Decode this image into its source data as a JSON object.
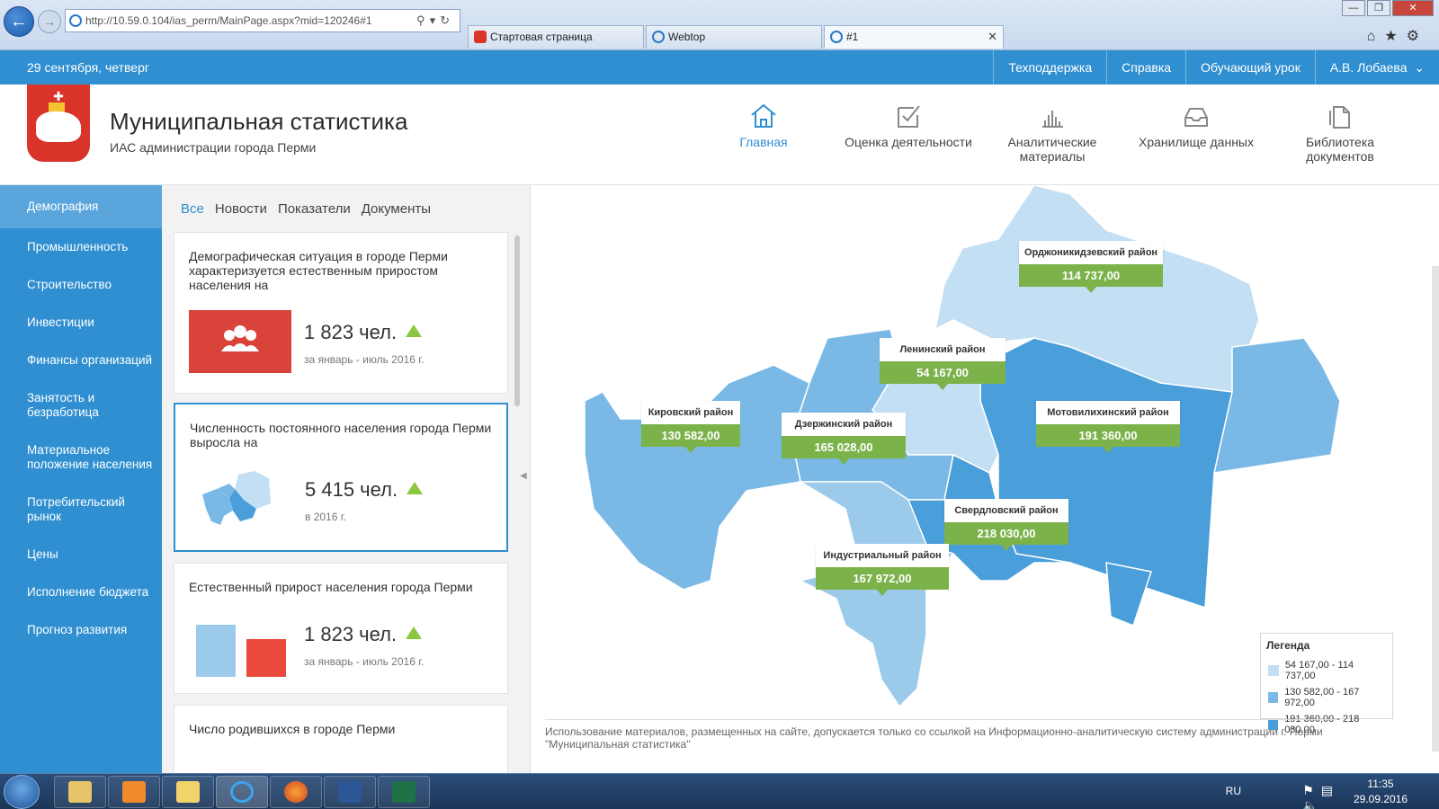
{
  "browser": {
    "address": "http://10.59.0.104/ias_perm/MainPage.aspx?mid=120246#1",
    "tabs": [
      "Стартовая страница",
      "Webtop",
      "#1"
    ]
  },
  "topbar": {
    "date": "29 сентября, четверг",
    "links": [
      "Техподдержка",
      "Справка",
      "Обучающий урок",
      "А.В. Лобаева"
    ]
  },
  "header": {
    "title": "Муниципальная статистика",
    "subtitle": "ИАС администрации города Перми",
    "nav": [
      "Главная",
      "Оценка деятельности",
      "Аналитические материалы",
      "Хранилище данных",
      "Библиотека документов"
    ]
  },
  "sidebar": {
    "items": [
      "Демография",
      "Промышленность",
      "Строительство",
      "Инвестиции",
      "Финансы организаций",
      "Занятость и безработица",
      "Материальное положение населения",
      "Потребительский рынок",
      "Цены",
      "Исполнение бюджета",
      "Прогноз развития"
    ]
  },
  "feed": {
    "tabs": [
      "Все",
      "Новости",
      "Показатели",
      "Документы"
    ],
    "cards": [
      {
        "text": "Демографическая ситуация в городе Перми характеризуется естественным приростом населения на",
        "value": "1 823 чел.",
        "period": "за январь - июль 2016 г."
      },
      {
        "text": "Численность постоянного населения города Перми выросла на",
        "value": "5 415 чел.",
        "period": "в 2016 г."
      },
      {
        "text": "Естественный прирост населения города Перми",
        "value": "1 823 чел.",
        "period": "за январь - июль 2016 г."
      },
      {
        "text": "Число родившихся в городе Перми",
        "value": "",
        "period": ""
      }
    ]
  },
  "map": {
    "districts": [
      {
        "name": "Орджоникидзевский район",
        "value": "114 737,00"
      },
      {
        "name": "Ленинский район",
        "value": "54 167,00"
      },
      {
        "name": "Кировский район",
        "value": "130 582,00"
      },
      {
        "name": "Дзержинский район",
        "value": "165 028,00"
      },
      {
        "name": "Мотовилихинский район",
        "value": "191 360,00"
      },
      {
        "name": "Свердловский район",
        "value": "218 030,00"
      },
      {
        "name": "Индустриальный район",
        "value": "167 972,00"
      }
    ],
    "legend": {
      "title": "Легенда",
      "ranges": [
        "54 167,00 - 114 737,00",
        "130 582,00 - 167 972,00",
        "191 360,00 - 218 030,00"
      ]
    },
    "colors": {
      "light": "#c3dff3",
      "medium": "#7ab9e5",
      "dark": "#4a9ed9",
      "label": "#7cb24a"
    },
    "footer": "Использование материалов, размещенных на сайте, допускается только со ссылкой на Информационно-аналитическую систему администрации г. Перми \"Муниципальная статистика\""
  },
  "taskbar": {
    "lang": "RU",
    "time": "11:35",
    "date": "29.09.2016"
  }
}
